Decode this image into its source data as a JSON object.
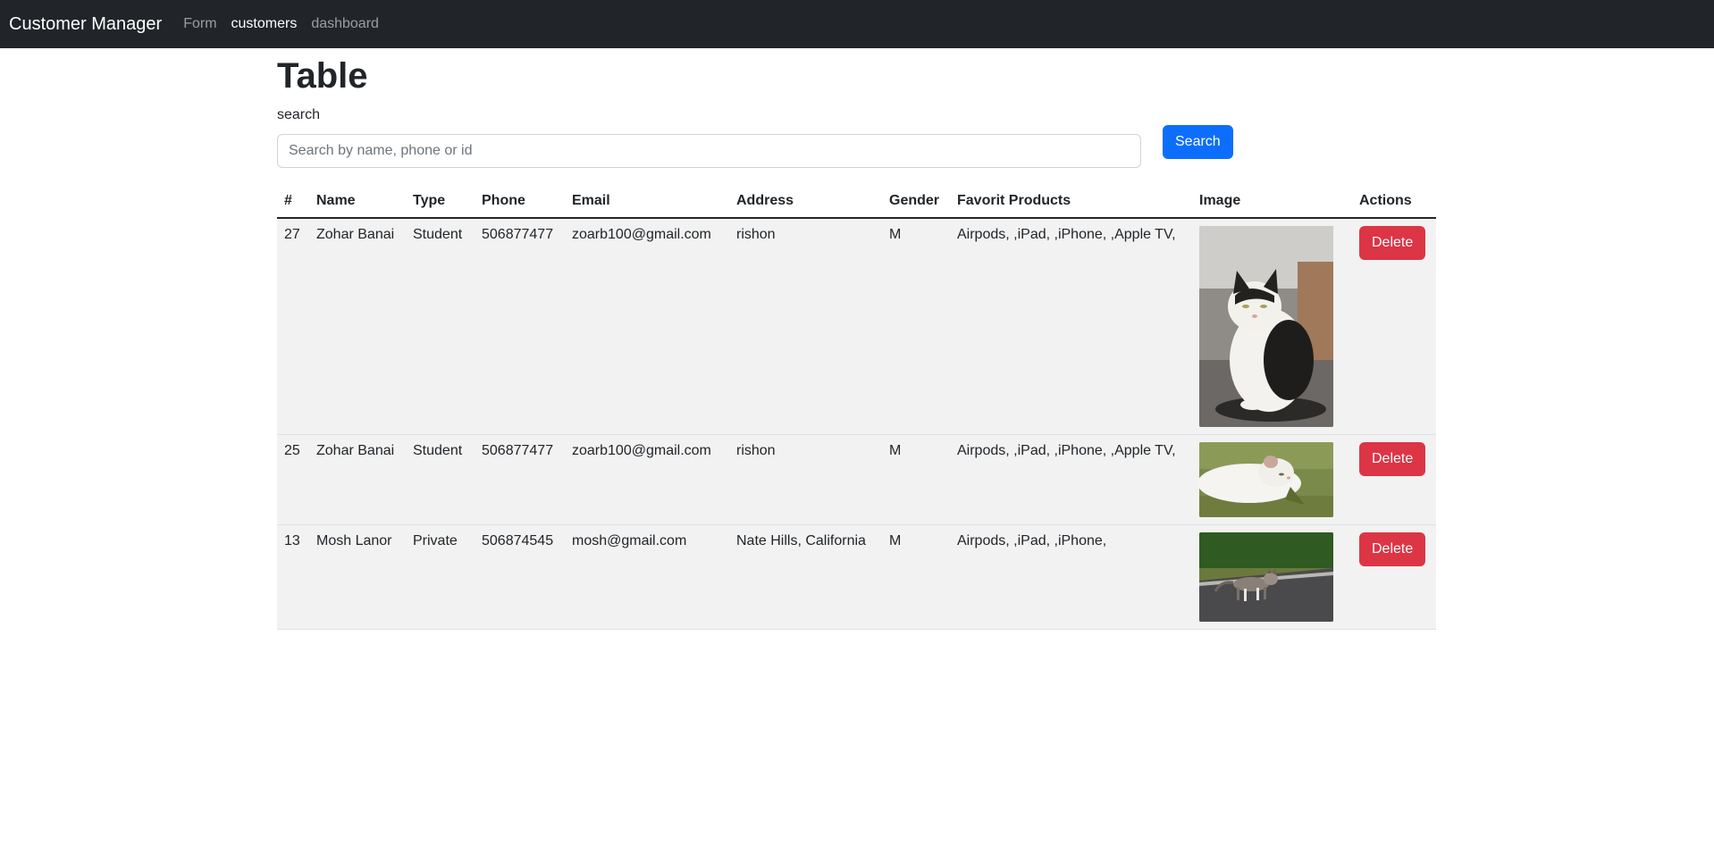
{
  "nav": {
    "brand": "Customer Manager",
    "links": [
      {
        "label": "Form",
        "active": false
      },
      {
        "label": "customers",
        "active": true
      },
      {
        "label": "dashboard",
        "active": false
      }
    ]
  },
  "page": {
    "title": "Table",
    "search_label": "search",
    "search_placeholder": "Search by name, phone or id",
    "search_value": "",
    "search_button": "Search"
  },
  "table": {
    "headers": [
      "#",
      "Name",
      "Type",
      "Phone",
      "Email",
      "Address",
      "Gender",
      "Favorit Products",
      "Image",
      "Actions"
    ],
    "rows": [
      {
        "id": "27",
        "name": "Zohar Banai",
        "type": "Student",
        "phone": "506877477",
        "email": "zoarb100@gmail.com",
        "address": "rishon",
        "gender": "M",
        "products": "Airpods, ,iPad, ,iPhone, ,Apple TV,",
        "image": "cat-black-white-sitting-photo",
        "action": "Delete"
      },
      {
        "id": "25",
        "name": "Zohar Banai",
        "type": "Student",
        "phone": "506877477",
        "email": "zoarb100@gmail.com",
        "address": "rishon",
        "gender": "M",
        "products": "Airpods, ,iPad, ,iPhone, ,Apple TV,",
        "image": "cat-white-on-grass-photo",
        "action": "Delete"
      },
      {
        "id": "13",
        "name": "Mosh Lanor",
        "type": "Private",
        "phone": "506874545",
        "email": "mosh@gmail.com",
        "address": "Nate Hills, California",
        "gender": "M",
        "products": "Airpods, ,iPad, ,iPhone,",
        "image": "cat-tabby-on-road-photo",
        "action": "Delete"
      }
    ]
  },
  "colors": {
    "navbar": "#212529",
    "primary": "#0d6efd",
    "danger": "#dc3545",
    "row_bg": "#f2f2f2"
  }
}
